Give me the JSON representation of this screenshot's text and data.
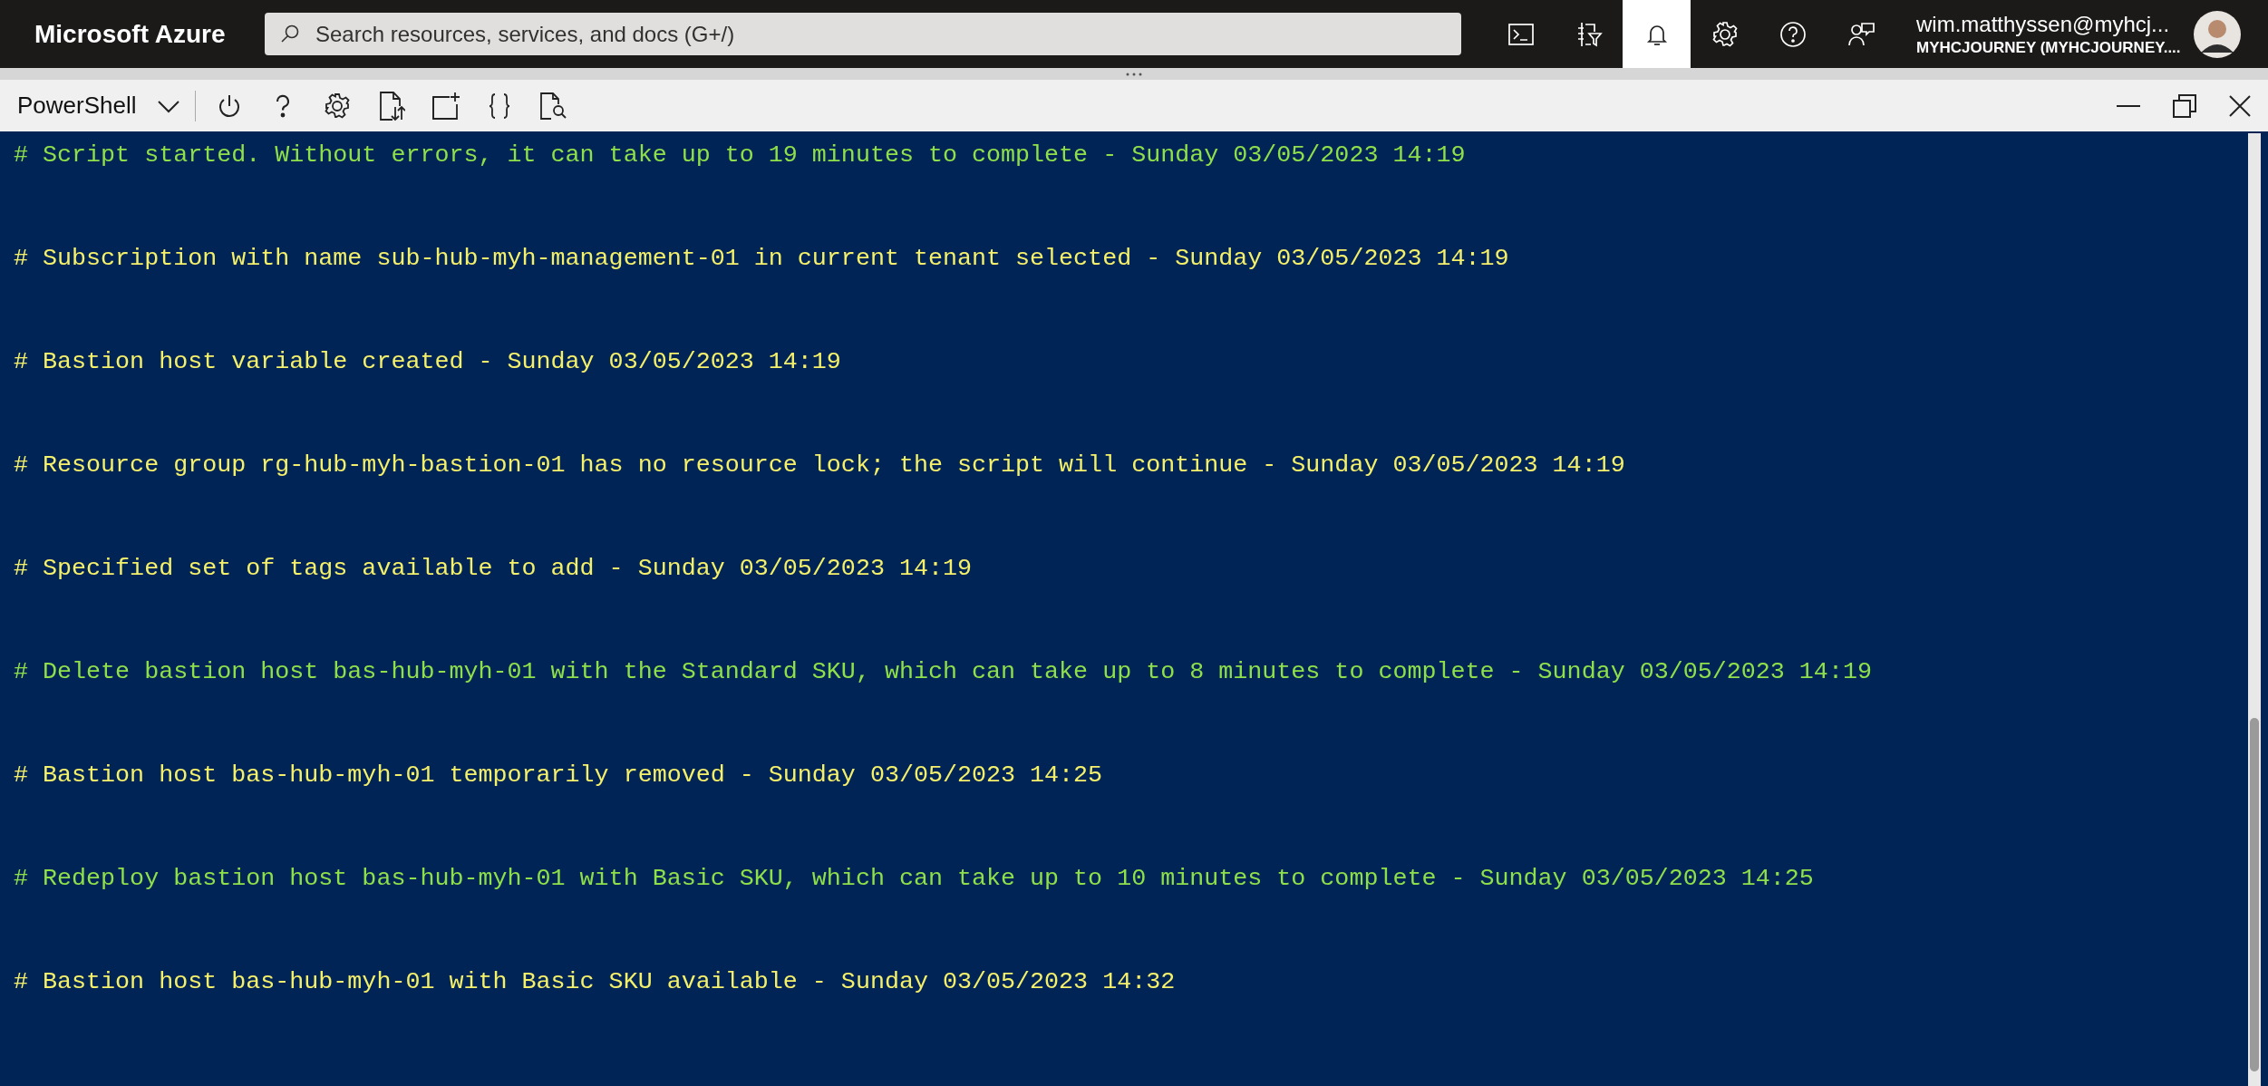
{
  "top_bar": {
    "brand": "Microsoft Azure",
    "search": {
      "placeholder": "Search resources, services, and docs (G+/)"
    },
    "buttons": [
      {
        "kind": "shell",
        "selected": false
      },
      {
        "kind": "filter",
        "selected": false
      },
      {
        "kind": "bell",
        "selected": true
      },
      {
        "kind": "settings",
        "selected": false
      },
      {
        "kind": "help",
        "selected": false
      },
      {
        "kind": "feedback",
        "selected": false
      }
    ],
    "account": {
      "email": "wim.matthyssen@myhcj...",
      "directory": "MYHCJOURNEY (MYHCJOURNEY...."
    }
  },
  "toolbar": {
    "shell": "PowerShell"
  },
  "terminal": {
    "lines": [
      {
        "kind": "info",
        "text": "# Script started. Without errors, it can take up to 19 minutes to complete - Sunday 03/05/2023 14:19"
      },
      {
        "kind": "done",
        "text": "# Subscription with name sub-hub-myh-management-01 in current tenant selected - Sunday 03/05/2023 14:19"
      },
      {
        "kind": "done",
        "text": "# Bastion host variable created - Sunday 03/05/2023 14:19"
      },
      {
        "kind": "done",
        "text": "# Resource group rg-hub-myh-bastion-01 has no resource lock; the script will continue - Sunday 03/05/2023 14:19"
      },
      {
        "kind": "done",
        "text": "# Specified set of tags available to add - Sunday 03/05/2023 14:19"
      },
      {
        "kind": "info",
        "text": "# Delete bastion host bas-hub-myh-01 with the Standard SKU, which can take up to 8 minutes to complete - Sunday 03/05/2023 14:19"
      },
      {
        "kind": "done",
        "text": "# Bastion host bas-hub-myh-01 temporarily removed - Sunday 03/05/2023 14:25"
      },
      {
        "kind": "info",
        "text": "# Redeploy bastion host bas-hub-myh-01 with Basic SKU, which can take up to 10 minutes to complete - Sunday 03/05/2023 14:25"
      },
      {
        "kind": "done",
        "text": "# Bastion host bas-hub-myh-01 with Basic SKU available - Sunday 03/05/2023 14:32"
      }
    ]
  }
}
